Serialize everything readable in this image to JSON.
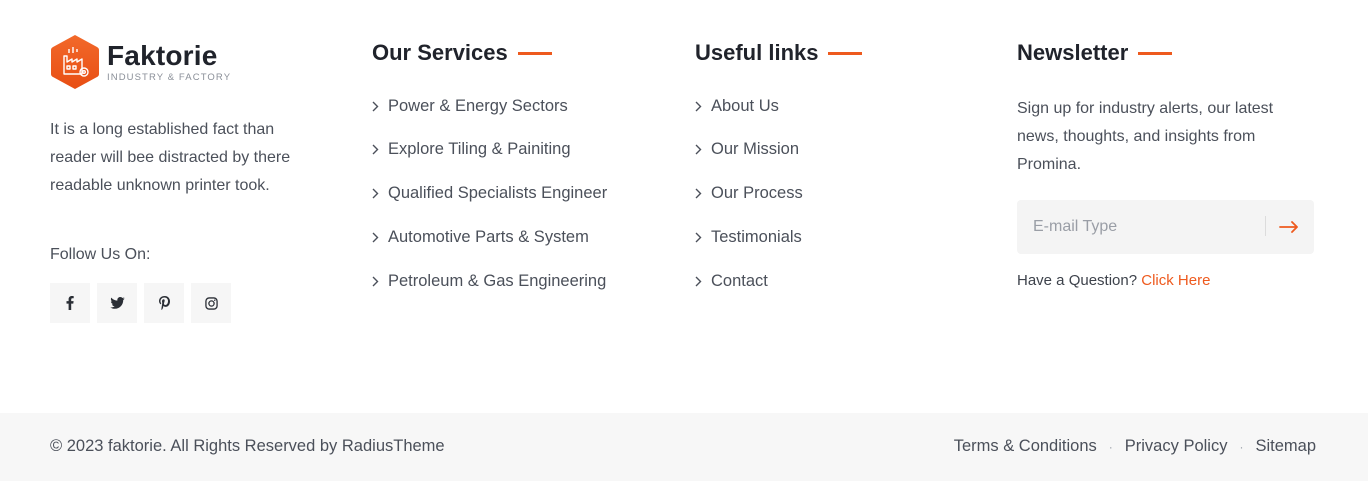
{
  "brand": {
    "name": "Faktorie",
    "tagline": "INDUSTRY & FACTORY",
    "about": "It is a long established fact than reader will bee distracted by there readable unknown printer took.",
    "follow_label": "Follow Us On:",
    "socials": [
      {
        "icon": "facebook-icon"
      },
      {
        "icon": "twitter-icon"
      },
      {
        "icon": "pinterest-icon"
      },
      {
        "icon": "instagram-icon"
      }
    ],
    "accent_color": "#ee5a1e"
  },
  "services": {
    "heading": "Our Services",
    "items": [
      "Power & Energy Sectors",
      "Explore Tiling & Painiting",
      "Qualified Specialists Engineer",
      "Automotive Parts & System",
      "Petroleum & Gas Engineering"
    ]
  },
  "links": {
    "heading": "Useful links",
    "items": [
      "About Us",
      "Our Mission",
      "Our Process",
      "Testimonials",
      "Contact"
    ]
  },
  "newsletter": {
    "heading": "Newsletter",
    "text": "Sign up for industry alerts, our latest news, thoughts, and insights from Promina.",
    "email_placeholder": "E-mail Type",
    "question_text": "Have a Question?",
    "question_link": "Click Here"
  },
  "footer": {
    "copyright": "© 2023 faktorie. All Rights Reserved by RadiusTheme",
    "legal": [
      "Terms & Conditions",
      "Privacy Policy",
      "Sitemap"
    ]
  }
}
